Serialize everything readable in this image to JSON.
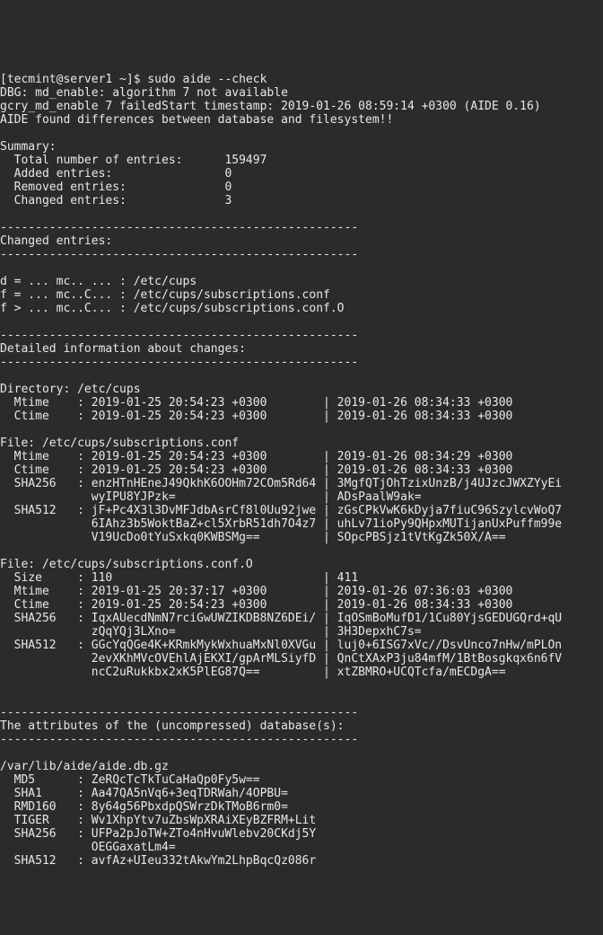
{
  "prompt": "[tecmint@server1 ~]$ sudo aide --check",
  "dbg1": "DBG: md_enable: algorithm 7 not available",
  "dbg2": "gcry_md_enable 7 failedStart timestamp: 2019-01-26 08:59:14 +0300 (AIDE 0.16)",
  "found": "AIDE found differences between database and filesystem!!",
  "summary_hdr": "Summary:",
  "sum_total": "  Total number of entries:      159497",
  "sum_added": "  Added entries:                0",
  "sum_removed": "  Removed entries:              0",
  "sum_changed": "  Changed entries:              3",
  "dash": "---------------------------------------------------",
  "changed_hdr": "Changed entries:",
  "ce1": "d = ... mc.. ... : /etc/cups",
  "ce2": "f = ... mc..C... : /etc/cups/subscriptions.conf",
  "ce3": "f > ... mc..C... : /etc/cups/subscriptions.conf.O",
  "detail_hdr": "Detailed information about changes:",
  "dir_hdr": "Directory: /etc/cups",
  "dir_mtime": "  Mtime    : 2019-01-25 20:54:23 +0300        | 2019-01-26 08:34:33 +0300",
  "dir_ctime": "  Ctime    : 2019-01-25 20:54:23 +0300        | 2019-01-26 08:34:33 +0300",
  "f1_hdr": "File: /etc/cups/subscriptions.conf",
  "f1_mtime": "  Mtime    : 2019-01-25 20:54:23 +0300        | 2019-01-26 08:34:29 +0300",
  "f1_ctime": "  Ctime    : 2019-01-25 20:54:23 +0300        | 2019-01-26 08:34:33 +0300",
  "f1_sha256a": "  SHA256   : enzHTnHEneJ49QkhK6OOHm72COm5Rd64 | 3MgfQTjOhTzixUnzB/j4UJzcJWXZYyEi",
  "f1_sha256b": "             wyIPU8YJPzk=                     | ADsPaalW9ak=",
  "f1_sha512a": "  SHA512   : jF+Pc4X3l3DvMFJdbAsrCf8l0Uu92jwe | zGsCPkVwK6kDyja7fiuC96SzylcvWoQ7",
  "f1_sha512b": "             6IAhz3b5WoktBaZ+cl5XrbR51dh7O4z7 | uhLv71ioPy9QHpxMUTijanUxPuffm99e",
  "f1_sha512c": "             V19UcDo0tYuSxkq0KWBSMg==         | SOpcPBSjz1tVtKgZk50X/A==",
  "f2_hdr": "File: /etc/cups/subscriptions.conf.O",
  "f2_size": "  Size     : 110                              | 411",
  "f2_mtime": "  Mtime    : 2019-01-25 20:37:17 +0300        | 2019-01-26 07:36:03 +0300",
  "f2_ctime": "  Ctime    : 2019-01-25 20:54:23 +0300        | 2019-01-26 08:34:33 +0300",
  "f2_sha256a": "  SHA256   : IqxAUecdNmN7rciGwUWZIKDB8NZ6DEi/ | IqOSmBoMufD1/1Cu80YjsGEDUGQrd+qU",
  "f2_sha256b": "             zQqYQj3LXno=                     | 3H3DepxhC7s=",
  "f2_sha512a": "  SHA512   : GGcYqQGe4K+KRmkMykWxhuaMxNl0XVGu | luj0+6ISG7xVc//DsvUnco7nHw/mPLOn",
  "f2_sha512b": "             2evXKhMVcOVEhlAjEKXI/gpArMLSiyfD | QnCtXAxP3ju84mfM/1BtBosgkqx6n6fV",
  "f2_sha512c": "             ncC2uRukkbx2xK5PlEG87Q==         | xtZBMRO+UCQTcfa/mECDgA==",
  "attr_hdr": "The attributes of the (uncompressed) database(s):",
  "db_path": "/var/lib/aide/aide.db.gz",
  "db_md5": "  MD5      : ZeRQcTcTkTuCaHaQp0Fy5w==",
  "db_sha1": "  SHA1     : Aa47QA5nVq6+3eqTDRWah/4OPBU=",
  "db_rmd160": "  RMD160   : 8y64g56PbxdpQSWrzDkTMoB6rm0=",
  "db_tiger": "  TIGER    : Wv1XhpYtv7uZbsWpXRAiXEyBZFRM+Lit",
  "db_sha256a": "  SHA256   : UFPa2pJoTW+ZTo4nHvuWlebv20CKdj5Y",
  "db_sha256b": "             OEGGaxatLm4=",
  "db_sha512": "  SHA512   : avfAz+UIeu332tAkwYm2LhpBqcQz086r"
}
